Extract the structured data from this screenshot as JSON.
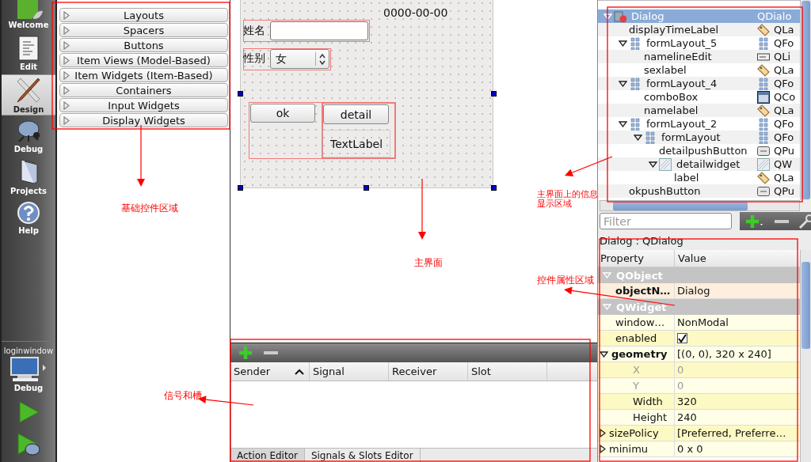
{
  "mode_bar": {
    "modes": [
      {
        "label": "Welcome",
        "selected": false
      },
      {
        "label": "Edit",
        "selected": false
      },
      {
        "label": "Design",
        "selected": true
      },
      {
        "label": "Debug",
        "selected": false
      },
      {
        "label": "Projects",
        "selected": false
      },
      {
        "label": "Help",
        "selected": false
      }
    ],
    "session": {
      "project": "loginwindow",
      "target": "Debug"
    }
  },
  "widget_box": {
    "categories": [
      {
        "label": "Layouts",
        "expanded": false
      },
      {
        "label": "Spacers",
        "expanded": false
      },
      {
        "label": "Buttons",
        "expanded": false
      },
      {
        "label": "Item Views (Model-Based)",
        "expanded": false
      },
      {
        "label": "Item Widgets (Item-Based)",
        "expanded": false
      },
      {
        "label": "Containers",
        "expanded": false
      },
      {
        "label": "Input Widgets",
        "expanded": false
      },
      {
        "label": "Display Widgets",
        "expanded": false
      }
    ]
  },
  "form": {
    "date_label": "0000-00-00",
    "name_label": "姓名",
    "sex_label": "性别",
    "sex_value": "女",
    "ok_button": "ok",
    "detail_button": "detail",
    "text_label": "TextLabel"
  },
  "signal_slot_editor": {
    "columns": [
      {
        "label": "Sender",
        "sorted": true
      },
      {
        "label": "Signal",
        "sorted": false
      },
      {
        "label": "Receiver",
        "sorted": false
      },
      {
        "label": "Slot",
        "sorted": false
      }
    ],
    "tabs": [
      {
        "label": "Action Editor",
        "selected": true
      },
      {
        "label": "Signals & Slots Editor",
        "selected": false
      }
    ]
  },
  "object_inspector": {
    "tree": [
      {
        "name": "Dialog",
        "class": "QDialo",
        "kind": "dialog",
        "selected": true,
        "expanded": true,
        "children": [
          {
            "name": "displayTimeLabel",
            "class": "QLa",
            "kind": "label",
            "selected": false
          },
          {
            "name": "formLayout_5",
            "class": "QFo",
            "kind": "layout",
            "selected": false,
            "expanded": true,
            "children": [
              {
                "name": "namelineEdit",
                "class": "QLi",
                "kind": "line-edit",
                "selected": false
              },
              {
                "name": "sexlabel",
                "class": "QLa",
                "kind": "label",
                "selected": false
              }
            ]
          },
          {
            "name": "formLayout_4",
            "class": "QFo",
            "kind": "layout",
            "selected": false,
            "expanded": true,
            "children": [
              {
                "name": "comboBox",
                "class": "QCo",
                "kind": "combo",
                "selected": false
              },
              {
                "name": "namelabel",
                "class": "QLa",
                "kind": "label",
                "selected": false
              }
            ]
          },
          {
            "name": "formLayout_2",
            "class": "QFo",
            "kind": "layout",
            "selected": false,
            "expanded": true,
            "children": [
              {
                "name": "formLayout",
                "class": "QFo",
                "kind": "layout",
                "selected": false,
                "expanded": true,
                "children": [
                  {
                    "name": "detailpushButton",
                    "class": "QPu",
                    "kind": "button",
                    "selected": false
                  },
                  {
                    "name": "detailwidget",
                    "class": "QW",
                    "kind": "widget",
                    "selected": false,
                    "expanded": true,
                    "children": [
                      {
                        "name": "label",
                        "class": "QLa",
                        "kind": "label",
                        "selected": false
                      }
                    ]
                  }
                ]
              }
            ]
          },
          {
            "name": "okpushButton",
            "class": "QPu",
            "kind": "button",
            "selected": false
          }
        ]
      }
    ],
    "filter_placeholder": "Filter"
  },
  "property_editor": {
    "title": "Dialog : QDialog",
    "columns": [
      "Property",
      "Value"
    ],
    "groups": [
      {
        "name": "QObject",
        "expanded": true,
        "rows": [
          {
            "kind": "text",
            "name": "objectN…",
            "value": "Dialog",
            "modified": true
          }
        ]
      },
      {
        "name": "QWidget",
        "expanded": true,
        "rows": [
          {
            "kind": "text",
            "name": "window…",
            "value": "NonModal",
            "modified": false
          },
          {
            "kind": "check",
            "name": "enabled",
            "checked": true,
            "modified": false
          },
          {
            "kind": "text",
            "name": "geometry",
            "value": "[(0, 0), 320 x 240]",
            "modified": true,
            "expanded": true,
            "children": [
              {
                "kind": "text",
                "name": "X",
                "value": "0",
                "disabled": true
              },
              {
                "kind": "text",
                "name": "Y",
                "value": "0",
                "disabled": true
              },
              {
                "kind": "text",
                "name": "Width",
                "value": "320",
                "disabled": false
              },
              {
                "kind": "text",
                "name": "Height",
                "value": "240",
                "disabled": false
              }
            ]
          },
          {
            "kind": "text",
            "name": "sizePolicy",
            "value": "[Preferred, Preferre…",
            "modified": false,
            "expanded": false
          },
          {
            "kind": "text",
            "name": "minimu",
            "value": "0 x 0",
            "modified": false,
            "expanded": false
          }
        ]
      }
    ]
  },
  "annotations": [
    {
      "text": "基础控件区域"
    },
    {
      "text": "主界面上的信息显示区域"
    },
    {
      "text": "主界面"
    },
    {
      "text": "控件属性区域"
    },
    {
      "text": "信号和槽"
    }
  ]
}
